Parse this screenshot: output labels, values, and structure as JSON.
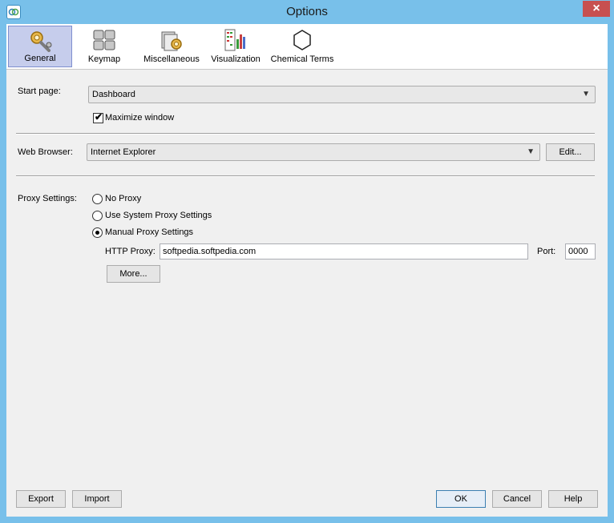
{
  "window": {
    "title": "Options",
    "close_glyph": "×"
  },
  "toolbar": {
    "items": [
      {
        "label": "General",
        "icon": "gear-wrench-icon",
        "active": true
      },
      {
        "label": "Keymap",
        "icon": "keyboard-icon",
        "active": false
      },
      {
        "label": "Miscellaneous",
        "icon": "misc-gear-icon",
        "active": false
      },
      {
        "label": "Visualization",
        "icon": "visualization-icon",
        "active": false
      },
      {
        "label": "Chemical Terms",
        "icon": "hexagon-icon",
        "active": false
      }
    ]
  },
  "general": {
    "start_page_label": "Start page:",
    "start_page_value": "Dashboard",
    "maximize_label": "Maximize window",
    "maximize_checked": true,
    "web_browser_label": "Web Browser:",
    "web_browser_value": "Internet Explorer",
    "edit_label": "Edit...",
    "proxy_label": "Proxy Settings:",
    "proxy_options": [
      "No Proxy",
      "Use System Proxy Settings",
      "Manual Proxy Settings"
    ],
    "proxy_selected": 2,
    "http_proxy_label": "HTTP Proxy:",
    "http_proxy_value": "softpedia.softpedia.com",
    "port_label": "Port:",
    "port_value": "0000",
    "more_label": "More..."
  },
  "footer": {
    "export_label": "Export",
    "import_label": "Import",
    "ok_label": "OK",
    "cancel_label": "Cancel",
    "help_label": "Help"
  },
  "colors": {
    "accent": "#c6cdec",
    "frame": "#78c0ea",
    "close": "#c75050"
  }
}
